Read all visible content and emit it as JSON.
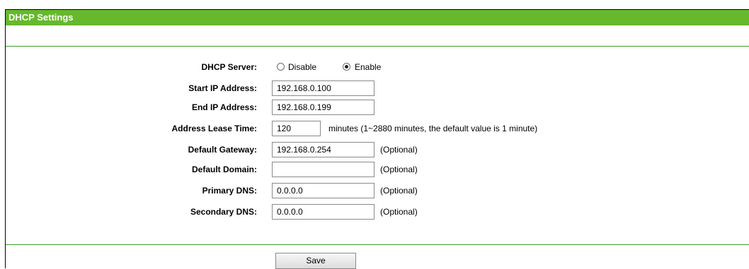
{
  "header": {
    "title": "DHCP Settings"
  },
  "dhcp_server": {
    "label": "DHCP Server:",
    "options": [
      "Disable",
      "Enable"
    ],
    "selected": "Enable"
  },
  "start_ip": {
    "label": "Start IP Address:",
    "value": "192.168.0.100"
  },
  "end_ip": {
    "label": "End IP Address:",
    "value": "192.168.0.199"
  },
  "lease": {
    "label": "Address Lease Time:",
    "value": "120",
    "hint": "minutes (1~2880 minutes, the default value is 1 minute)"
  },
  "gateway": {
    "label": "Default Gateway:",
    "value": "192.168.0.254",
    "hint": "(Optional)"
  },
  "domain": {
    "label": "Default Domain:",
    "value": "",
    "hint": "(Optional)"
  },
  "primary_dns": {
    "label": "Primary DNS:",
    "value": "0.0.0.0",
    "hint": "(Optional)"
  },
  "secondary_dns": {
    "label": "Secondary DNS:",
    "value": "0.0.0.0",
    "hint": "(Optional)"
  },
  "buttons": {
    "save": "Save"
  }
}
